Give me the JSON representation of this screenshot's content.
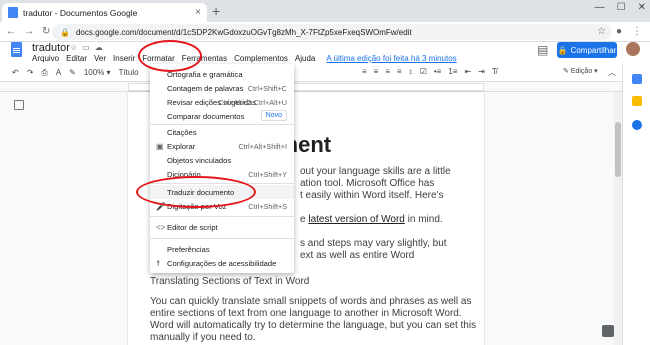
{
  "browser": {
    "tab_title": "tradutor - Documentos Google",
    "tab_close": "×",
    "new_tab": "+",
    "url": "docs.google.com/document/d/1cSDP2KwGdoxzuOGvTg8zMh_X-7FtZp5xeFxeqSWOmFw/edit",
    "window_controls": [
      "—",
      "☐",
      "✕"
    ]
  },
  "doc": {
    "title": "tradutor",
    "menus": [
      "Arquivo",
      "Editar",
      "Ver",
      "Inserir",
      "Formatar",
      "Ferramentas",
      "Complementos",
      "Ajuda"
    ],
    "last_edit": "A última edição foi feita há 3 minutos",
    "share_label": "Compartilhar",
    "style_select": "Título",
    "editing_mode": "Edição"
  },
  "tools_menu": {
    "items": [
      {
        "label": "Ortografia e gramática",
        "shortcut": "",
        "icon": ""
      },
      {
        "label": "Contagem de palavras",
        "shortcut": "Ctrl+Shift+C",
        "icon": ""
      },
      {
        "label": "Revisar edições sugeridas",
        "shortcut": "Ctrl+Alt+O Ctrl+Alt+U",
        "icon": ""
      },
      {
        "label": "Comparar documentos",
        "shortcut": "",
        "icon": "",
        "badge": "Novo"
      },
      {
        "label": "Citações",
        "shortcut": "",
        "icon": ""
      },
      {
        "label": "Explorar",
        "shortcut": "Ctrl+Alt+Shift+I",
        "icon": "explore-icon"
      },
      {
        "label": "Objetos vinculados",
        "shortcut": "",
        "icon": ""
      },
      {
        "label": "Dicionário",
        "shortcut": "Ctrl+Shift+Y",
        "icon": ""
      },
      {
        "label": "Traduzir documento",
        "shortcut": "",
        "icon": ""
      },
      {
        "label": "Digitação por Voz",
        "shortcut": "Ctrl+Shift+S",
        "icon": "microphone-icon"
      },
      {
        "label": "Editor de script",
        "shortcut": "",
        "icon": "code-icon"
      },
      {
        "label": "Preferências",
        "shortcut": "",
        "icon": ""
      },
      {
        "label": "Configurações de acessibilidade",
        "shortcut": "",
        "icon": "accessibility-icon"
      }
    ]
  },
  "page": {
    "heading": "document",
    "lines": [
      "out your language skills are a little",
      "ation tool. Microsoft Office has",
      "t easily within Word itself. Here's",
      "e latest version of Word in mind.",
      "s and steps may vary slightly, but",
      "ext as well as entire Word",
      "Translating Sections of Text in Word",
      "You can quickly translate small snippets of words and phrases as well as",
      "entire sections of text from one language to another in Microsoft Word.",
      "Word will automatically try to determine the language, but you can set this",
      "manually if you need to."
    ],
    "link_fragment": "latest version of Word"
  },
  "colors": {
    "accent": "#1a73e8",
    "annotation": "#e1181b"
  }
}
